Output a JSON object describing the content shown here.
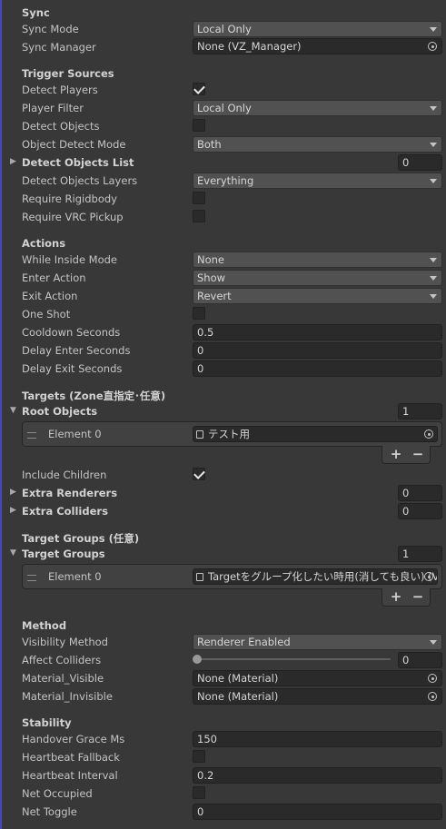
{
  "sections": {
    "sync": "Sync",
    "trigger_sources": "Trigger Sources",
    "actions": "Actions",
    "targets": "Targets (Zone直指定･任意)",
    "target_groups": "Target Groups (任意)",
    "method": "Method",
    "stability": "Stability"
  },
  "fields": {
    "sync_mode": {
      "label": "Sync Mode",
      "value": "Local Only"
    },
    "sync_manager": {
      "label": "Sync Manager",
      "value": "None (VZ_Manager)"
    },
    "detect_players": {
      "label": "Detect Players",
      "checked": true
    },
    "player_filter": {
      "label": "Player Filter",
      "value": "Local Only"
    },
    "detect_objects": {
      "label": "Detect Objects",
      "checked": false
    },
    "object_detect_mode": {
      "label": "Object Detect Mode",
      "value": "Both"
    },
    "detect_objects_list": {
      "label": "Detect Objects List",
      "size": "0"
    },
    "detect_objects_layers": {
      "label": "Detect Objects Layers",
      "value": "Everything"
    },
    "require_rigidbody": {
      "label": "Require Rigidbody",
      "checked": false
    },
    "require_vrc_pickup": {
      "label": "Require VRC Pickup",
      "checked": false
    },
    "while_inside_mode": {
      "label": "While Inside Mode",
      "value": "None"
    },
    "enter_action": {
      "label": "Enter Action",
      "value": "Show"
    },
    "exit_action": {
      "label": "Exit Action",
      "value": "Revert"
    },
    "one_shot": {
      "label": "One Shot",
      "checked": false
    },
    "cooldown_seconds": {
      "label": "Cooldown Seconds",
      "value": "0.5"
    },
    "delay_enter_seconds": {
      "label": "Delay Enter Seconds",
      "value": "0"
    },
    "delay_exit_seconds": {
      "label": "Delay Exit Seconds",
      "value": "0"
    },
    "root_objects": {
      "label": "Root Objects",
      "size": "1",
      "element_label": "Element 0",
      "element_value": "テスト用"
    },
    "include_children": {
      "label": "Include Children",
      "checked": true
    },
    "extra_renderers": {
      "label": "Extra Renderers",
      "size": "0"
    },
    "extra_colliders": {
      "label": "Extra Colliders",
      "size": "0"
    },
    "target_groups": {
      "label": "Target Groups",
      "size": "1",
      "element_label": "Element 0",
      "element_value": "Targetをグループ化したい時用(消しても良い) (V"
    },
    "visibility_method": {
      "label": "Visibility Method",
      "value": "Renderer Enabled"
    },
    "affect_colliders": {
      "label": "Affect Colliders",
      "value": "0",
      "slider_fraction": 0
    },
    "material_visible": {
      "label": "Material_Visible",
      "value": "None (Material)"
    },
    "material_invisible": {
      "label": "Material_Invisible",
      "value": "None (Material)"
    },
    "handover_grace_ms": {
      "label": "Handover Grace Ms",
      "value": "150"
    },
    "heartbeat_fallback": {
      "label": "Heartbeat Fallback",
      "checked": false
    },
    "heartbeat_interval": {
      "label": "Heartbeat Interval",
      "value": "0.2"
    },
    "net_occupied": {
      "label": "Net Occupied",
      "checked": false
    },
    "net_toggle": {
      "label": "Net Toggle",
      "value": "0"
    }
  },
  "buttons": {
    "add": "+",
    "remove": "−"
  }
}
